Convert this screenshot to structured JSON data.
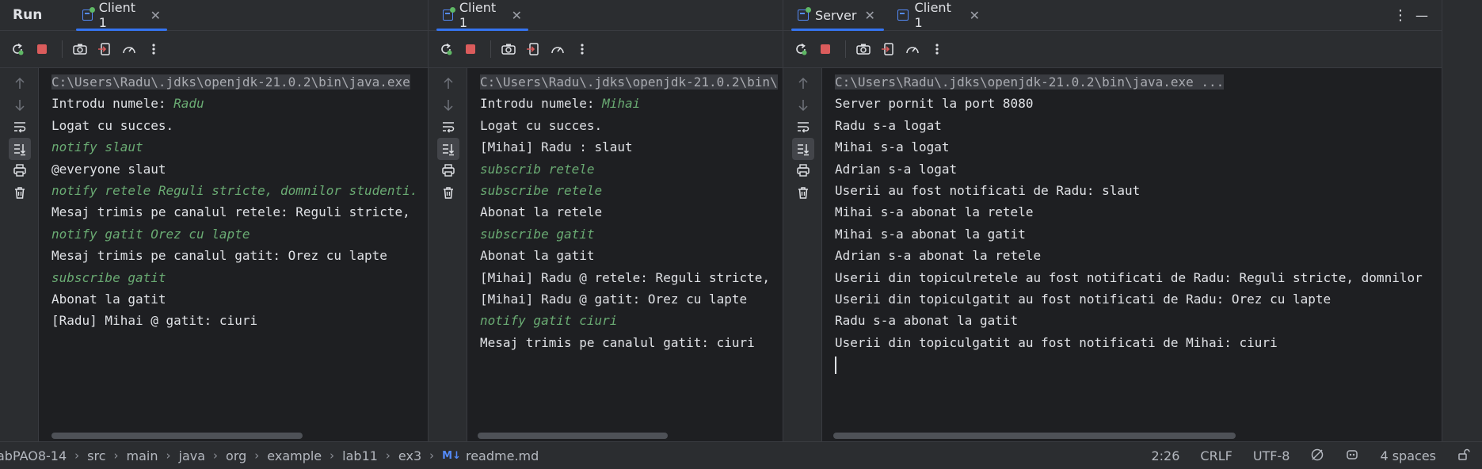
{
  "run_label": "Run",
  "panels": [
    {
      "tabs": [
        {
          "label": "Client 1",
          "close": "✕",
          "active": true
        }
      ],
      "lines": [
        {
          "kind": "cmd",
          "text": "C:\\Users\\Radu\\.jdks\\openjdk-21.0.2\\bin\\java.exe"
        },
        {
          "kind": "prompt",
          "text": "Introdu numele: ",
          "user": "Radu"
        },
        {
          "kind": "out",
          "text": "Logat cu succes."
        },
        {
          "kind": "input",
          "text": "notify slaut"
        },
        {
          "kind": "out",
          "text": "@everyone slaut"
        },
        {
          "kind": "input",
          "text": "notify retele Reguli stricte, domnilor studenti."
        },
        {
          "kind": "out",
          "text": "Mesaj trimis pe canalul retele: Reguli stricte,"
        },
        {
          "kind": "input",
          "text": "notify gatit Orez cu lapte"
        },
        {
          "kind": "out",
          "text": "Mesaj trimis pe canalul gatit: Orez cu lapte"
        },
        {
          "kind": "input",
          "text": "subscribe gatit"
        },
        {
          "kind": "out",
          "text": "Abonat la gatit"
        },
        {
          "kind": "out",
          "text": "[Radu] Mihai @ gatit: ciuri"
        }
      ]
    },
    {
      "tabs": [
        {
          "label": "Client 1",
          "close": "✕",
          "active": true
        }
      ],
      "lines": [
        {
          "kind": "cmd",
          "text": "C:\\Users\\Radu\\.jdks\\openjdk-21.0.2\\bin\\"
        },
        {
          "kind": "prompt",
          "text": "Introdu numele: ",
          "user": "Mihai"
        },
        {
          "kind": "out",
          "text": "Logat cu succes."
        },
        {
          "kind": "out",
          "text": "[Mihai] Radu : slaut"
        },
        {
          "kind": "input",
          "text": "subscrib retele"
        },
        {
          "kind": "input",
          "text": "subscribe retele"
        },
        {
          "kind": "out",
          "text": "Abonat la retele"
        },
        {
          "kind": "input",
          "text": "subscribe gatit"
        },
        {
          "kind": "out",
          "text": "Abonat la gatit"
        },
        {
          "kind": "out",
          "text": "[Mihai] Radu @ retele: Reguli stricte,"
        },
        {
          "kind": "out",
          "text": "[Mihai] Radu @ gatit: Orez cu lapte"
        },
        {
          "kind": "input",
          "text": "notify gatit ciuri"
        },
        {
          "kind": "out",
          "text": "Mesaj trimis pe canalul gatit: ciuri"
        }
      ]
    },
    {
      "tabs": [
        {
          "label": "Server",
          "close": "✕",
          "active": true
        },
        {
          "label": "Client 1",
          "close": "✕",
          "active": false
        }
      ],
      "lines": [
        {
          "kind": "cmd",
          "text": "C:\\Users\\Radu\\.jdks\\openjdk-21.0.2\\bin\\java.exe ..."
        },
        {
          "kind": "out",
          "text": "Server pornit la port 8080"
        },
        {
          "kind": "out",
          "text": "Radu s-a logat"
        },
        {
          "kind": "out",
          "text": "Mihai s-a logat"
        },
        {
          "kind": "out",
          "text": "Adrian s-a logat"
        },
        {
          "kind": "out",
          "text": "Userii au fost notificati de Radu: slaut"
        },
        {
          "kind": "out",
          "text": "Mihai s-a abonat la retele"
        },
        {
          "kind": "out",
          "text": "Mihai s-a abonat la gatit"
        },
        {
          "kind": "out",
          "text": "Adrian s-a abonat la retele"
        },
        {
          "kind": "out",
          "text": "Userii din topiculretele au fost notificati de Radu: Reguli stricte, domnilor"
        },
        {
          "kind": "out",
          "text": "Userii din topiculgatit au fost notificati de Radu: Orez cu lapte"
        },
        {
          "kind": "out",
          "text": "Radu s-a abonat la gatit"
        },
        {
          "kind": "out",
          "text": "Userii din topiculgatit au fost notificati de Mihai: ciuri"
        }
      ]
    }
  ],
  "toolbar_icons": [
    "rerun-icon",
    "stop-icon",
    "camera-icon",
    "import-icon",
    "gauge-icon",
    "more-icon"
  ],
  "gutter_icons": [
    "arrow-up-icon",
    "arrow-down-icon",
    "soft-wrap-icon",
    "scroll-to-end-icon",
    "print-icon",
    "trash-icon"
  ],
  "window_actions": {
    "more": "⋮",
    "minimize": "—"
  },
  "statusbar": {
    "breadcrumbs": [
      "abPAO8-14",
      "src",
      "main",
      "java",
      "org",
      "example",
      "lab11",
      "ex3"
    ],
    "file_badge": "M↓",
    "file": "readme.md",
    "position": "2:26",
    "line_ending": "CRLF",
    "encoding": "UTF-8",
    "indent": "4 spaces"
  },
  "colors": {
    "accent": "#3574f0",
    "input_green": "#6aab73",
    "stop_red": "#db5c5c",
    "rerun_green": "#5fb865"
  }
}
